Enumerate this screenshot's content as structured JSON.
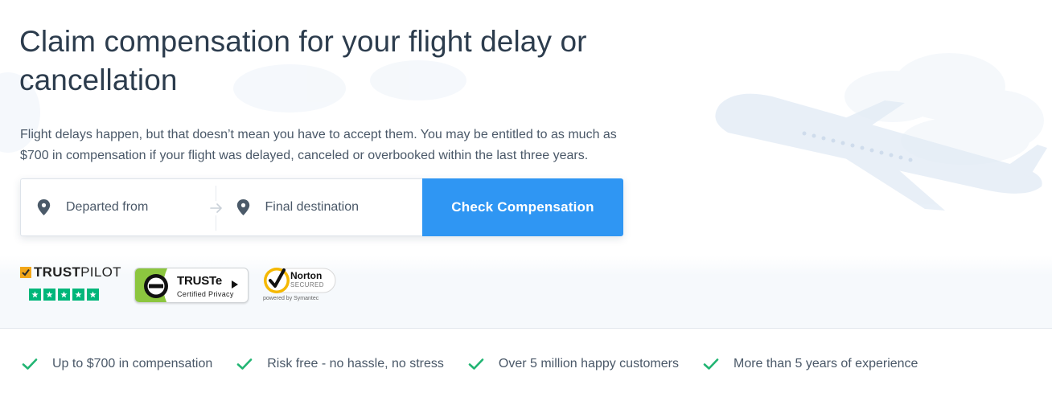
{
  "hero": {
    "title": "Claim compensation for your flight delay or cancellation",
    "intro": "Flight delays happen, but that doesn’t mean you have to accept them. You may be entitled to as much as $700 in compensation if your flight was delayed, canceled or overbooked within the last three years."
  },
  "search": {
    "from_placeholder": "Departed from",
    "to_placeholder": "Final destination",
    "button_label": "Check Compensation",
    "pin_icon": "location-pin-icon",
    "arrow_icon": "arrow-right-icon"
  },
  "badges": {
    "trustpilot": {
      "name_bold": "TRUST",
      "name_rest": "PILOT",
      "stars": 5
    },
    "truste": {
      "name": "TRUSTe",
      "subtitle": "Certified Privacy"
    },
    "norton": {
      "name": "Norton",
      "secured": "SECURED",
      "powered_by": "powered by Symantec"
    }
  },
  "benefits": [
    {
      "label": "Up to $700 in compensation"
    },
    {
      "label": "Risk free - no hassle, no stress"
    },
    {
      "label": "Over 5 million happy customers"
    },
    {
      "label": "More than 5 years of experience"
    }
  ],
  "colors": {
    "accent": "#2f96f3",
    "check_green": "#22b573",
    "trustpilot_green": "#00b67a",
    "heading": "#2c3c4d",
    "text": "#4a5868"
  }
}
